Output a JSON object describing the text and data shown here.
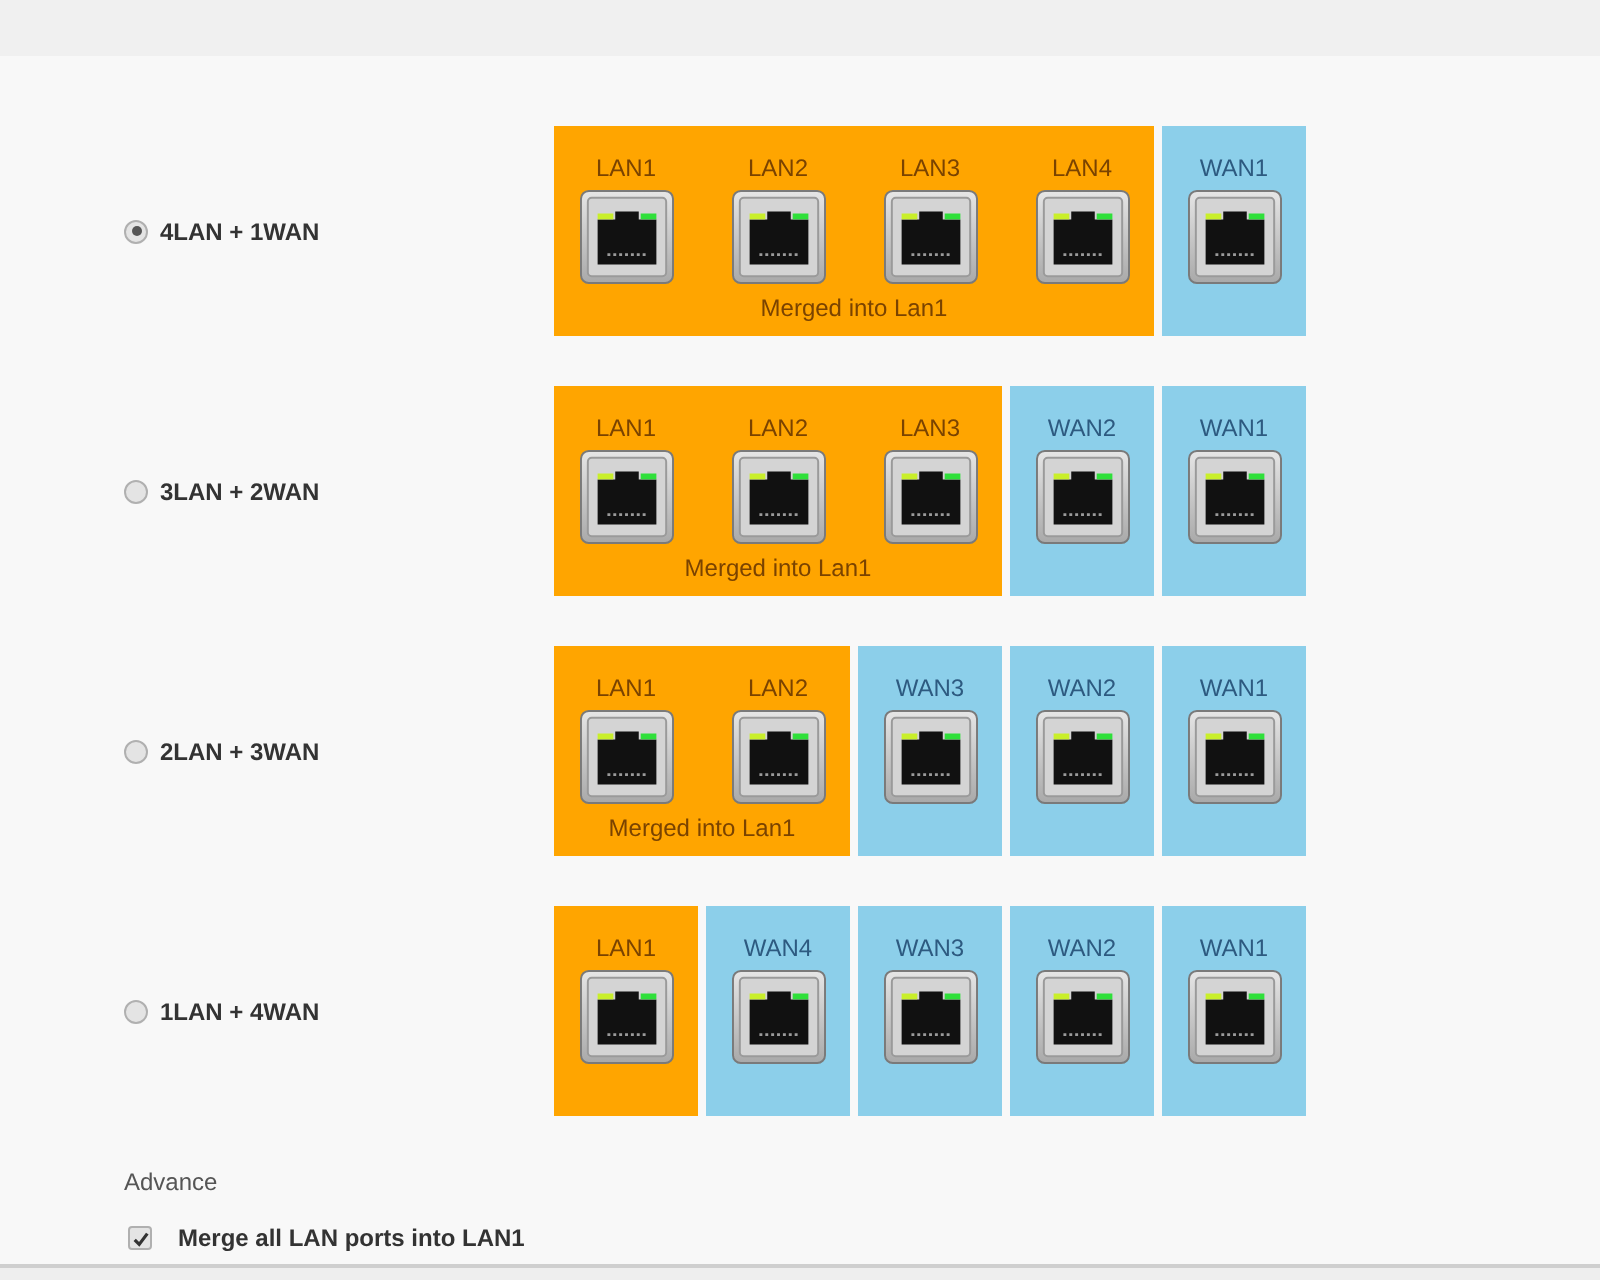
{
  "modes": [
    {
      "label": "4LAN + 1WAN",
      "selected": true,
      "panels": [
        {
          "kind": "lan",
          "ports": [
            "LAN1",
            "LAN2",
            "LAN3",
            "LAN4"
          ],
          "caption": "Merged into Lan1"
        },
        {
          "kind": "wan",
          "ports": [
            "WAN1"
          ]
        }
      ]
    },
    {
      "label": "3LAN + 2WAN",
      "selected": false,
      "panels": [
        {
          "kind": "lan",
          "ports": [
            "LAN1",
            "LAN2",
            "LAN3"
          ],
          "caption": "Merged into Lan1"
        },
        {
          "kind": "wan",
          "ports": [
            "WAN2"
          ]
        },
        {
          "kind": "wan",
          "ports": [
            "WAN1"
          ]
        }
      ]
    },
    {
      "label": "2LAN + 3WAN",
      "selected": false,
      "panels": [
        {
          "kind": "lan",
          "ports": [
            "LAN1",
            "LAN2"
          ],
          "caption": "Merged into Lan1"
        },
        {
          "kind": "wan",
          "ports": [
            "WAN3"
          ]
        },
        {
          "kind": "wan",
          "ports": [
            "WAN2"
          ]
        },
        {
          "kind": "wan",
          "ports": [
            "WAN1"
          ]
        }
      ]
    },
    {
      "label": "1LAN + 4WAN",
      "selected": false,
      "panels": [
        {
          "kind": "lan",
          "ports": [
            "LAN1"
          ]
        },
        {
          "kind": "wan",
          "ports": [
            "WAN4"
          ]
        },
        {
          "kind": "wan",
          "ports": [
            "WAN3"
          ]
        },
        {
          "kind": "wan",
          "ports": [
            "WAN2"
          ]
        },
        {
          "kind": "wan",
          "ports": [
            "WAN1"
          ]
        }
      ]
    }
  ],
  "advanced": {
    "title": "Advance",
    "option": {
      "label": "Merge all LAN ports into LAN1",
      "checked": true
    }
  }
}
